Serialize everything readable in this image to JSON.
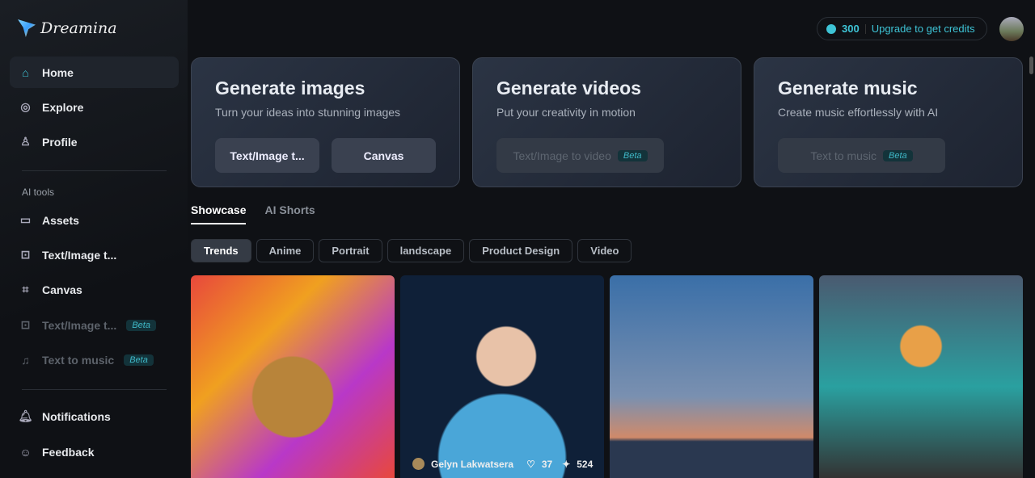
{
  "app": {
    "name": "Dreamina"
  },
  "sidebar": {
    "items": [
      {
        "label": "Home",
        "icon": "home-icon"
      },
      {
        "label": "Explore",
        "icon": "explore-icon"
      },
      {
        "label": "Profile",
        "icon": "profile-icon"
      }
    ],
    "section_label": "AI tools",
    "tools": [
      {
        "label": "Assets",
        "icon": "folder-icon"
      },
      {
        "label": "Text/Image t...",
        "icon": "image-icon"
      },
      {
        "label": "Canvas",
        "icon": "canvas-icon"
      },
      {
        "label": "Text/Image t...",
        "icon": "video-icon",
        "badge": "Beta"
      },
      {
        "label": "Text to music",
        "icon": "music-icon",
        "badge": "Beta"
      }
    ],
    "bottom": [
      {
        "label": "Notifications",
        "icon": "bell-icon"
      },
      {
        "label": "Feedback",
        "icon": "feedback-icon"
      }
    ]
  },
  "header": {
    "credits": "300",
    "upgrade": "Upgrade to get credits",
    "accent": "#3ec4d6"
  },
  "cards": [
    {
      "title": "Generate images",
      "subtitle": "Turn your ideas into stunning images",
      "buttons": [
        "Text/Image t...",
        "Canvas"
      ]
    },
    {
      "title": "Generate videos",
      "subtitle": "Put your creativity in motion",
      "button": "Text/Image to video",
      "badge": "Beta"
    },
    {
      "title": "Generate music",
      "subtitle": "Create music effortlessly with AI",
      "button": "Text to music",
      "badge": "Beta"
    }
  ],
  "tabs": [
    "Showcase",
    "AI Shorts"
  ],
  "chips": [
    "Trends",
    "Anime",
    "Portrait",
    "landscape",
    "Product Design",
    "Video"
  ],
  "showcase": {
    "hovered": {
      "author": "Gelyn Lakwatsera",
      "likes": "37",
      "remixes": "524"
    }
  }
}
